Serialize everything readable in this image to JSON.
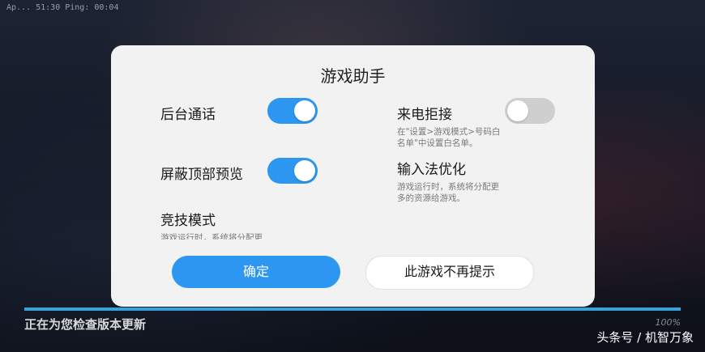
{
  "status_bar": {
    "info": "Ap... 51:30  Ping: 00:04"
  },
  "background": {
    "status_text": "正在为您检查版本更新",
    "progress_percent": "100%",
    "progress_fraction": 1.0,
    "watermark": "头条号 / 机智万象"
  },
  "dialog": {
    "title": "游戏助手",
    "settings": [
      {
        "label": "后台通话",
        "enabled": true
      },
      {
        "label": "来电拒接",
        "enabled": false,
        "desc_line1": "在\"设置>游戏模式>号码白",
        "desc_line2": "名单\"中设置白名单。"
      },
      {
        "label": "屏蔽顶部预览",
        "enabled": true
      },
      {
        "label": "输入法优化",
        "desc_line1": "游戏运行时，系统将分配更",
        "desc_line2": "多的资源给游戏。"
      },
      {
        "label": "竞技模式",
        "desc_line1": "游戏运行时，系统将分配更"
      }
    ],
    "confirm_label": "确定",
    "dont_remind_label": "此游戏不再提示"
  },
  "colors": {
    "accent": "#2d96f0",
    "toggle_off": "#cfcfcf",
    "dialog_bg": "#f2f2f2"
  }
}
